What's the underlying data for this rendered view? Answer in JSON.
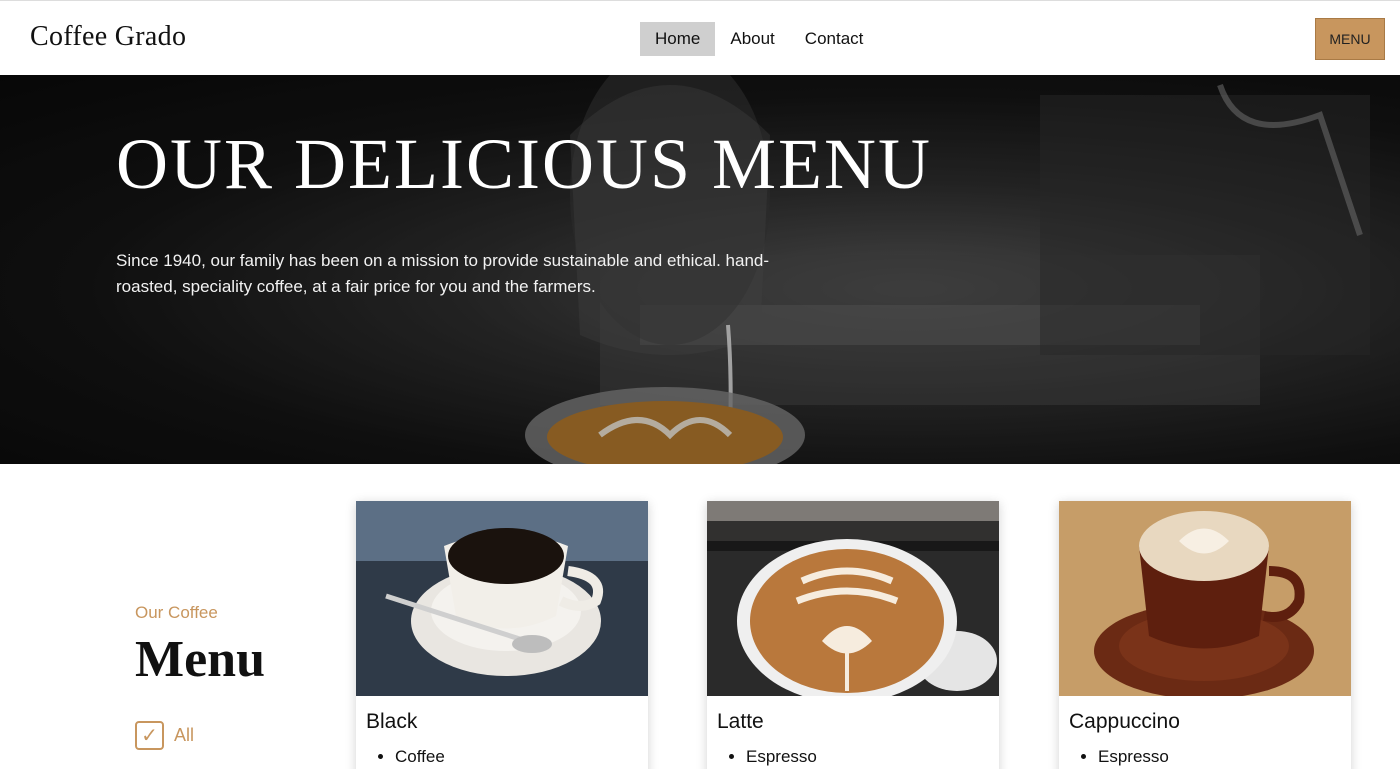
{
  "header": {
    "logo": "Coffee Grado",
    "nav": [
      "Home",
      "About",
      "Contact"
    ],
    "active_nav": "Home",
    "menu_button": "MENU"
  },
  "hero": {
    "title": "OUR DELICIOUS MENU",
    "text": "Since 1940, our family has been on a mission to provide sustainable and ethical. hand-roasted, speciality coffee, at a fair price for you and the farmers."
  },
  "menu_section": {
    "kicker": "Our Coffee",
    "title": "Menu",
    "filter_label": "All",
    "filter_checked": true
  },
  "cards": [
    {
      "title": "Black",
      "items": [
        "Coffee"
      ]
    },
    {
      "title": "Latte",
      "items": [
        "Espresso"
      ]
    },
    {
      "title": "Cappuccino",
      "items": [
        "Espresso"
      ]
    }
  ],
  "colors": {
    "accent": "#c8965e",
    "nav_active_bg": "#cfcfcf",
    "hero_bg": "#141414"
  }
}
